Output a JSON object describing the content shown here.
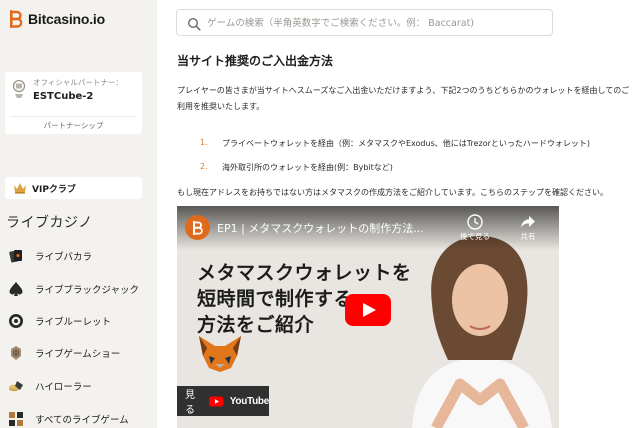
{
  "brand": {
    "name": "Bitcasino.io",
    "accent": "#e06a1b"
  },
  "sidebar": {
    "partner": {
      "label": "オフィシャルパートナー：",
      "name": "ESTCube-2",
      "link": "パートナーシップ"
    },
    "vip": {
      "label": "VIPクラブ",
      "icon": "crown-icon"
    },
    "section_title": "ライブカジノ",
    "items": [
      {
        "label": "ライブバカラ",
        "icon": "cards-icon"
      },
      {
        "label": "ライブブラックジャック",
        "icon": "spade-icon"
      },
      {
        "label": "ライブルーレット",
        "icon": "roulette-icon"
      },
      {
        "label": "ライブゲームショー",
        "icon": "gameshow-icon"
      },
      {
        "label": "ハイローラー",
        "icon": "chips-icon"
      },
      {
        "label": "すべてのライブゲーム",
        "icon": "grid-icon"
      }
    ]
  },
  "search": {
    "placeholder": "ゲームの検索（半角英数字でご検索ください。例： Baccarat)"
  },
  "main": {
    "heading": "当サイト推奨のご入出金方法",
    "intro": "プレイヤーの皆さまが当サイトへスムーズなご入出金いただけますよう、下記2つのうちどちらかのウォレットを経由してのご利用を推奨いたします。",
    "list": [
      {
        "num": "1.",
        "text": "プライベートウォレットを経由（例：メタマスクやExodus、他にはTrezorといったハードウォレット)"
      },
      {
        "num": "2.",
        "text": "海外取引所のウォレットを経由(例：Bybitなど)"
      }
    ],
    "note": "もし現在アドレスをお持ちではない方はメタマスクの作成方法をご紹介しています。こちらのステップを確認ください。"
  },
  "video": {
    "title": "EP1 | メタマスクウォレットの制作方法...",
    "watch_later": "後で見る",
    "share": "共有",
    "overlay_lines": [
      "メタマスクウォレットを",
      "短時間で制作する",
      "方法をご紹介"
    ],
    "watch_on": "見る",
    "youtube": "YouTube"
  }
}
